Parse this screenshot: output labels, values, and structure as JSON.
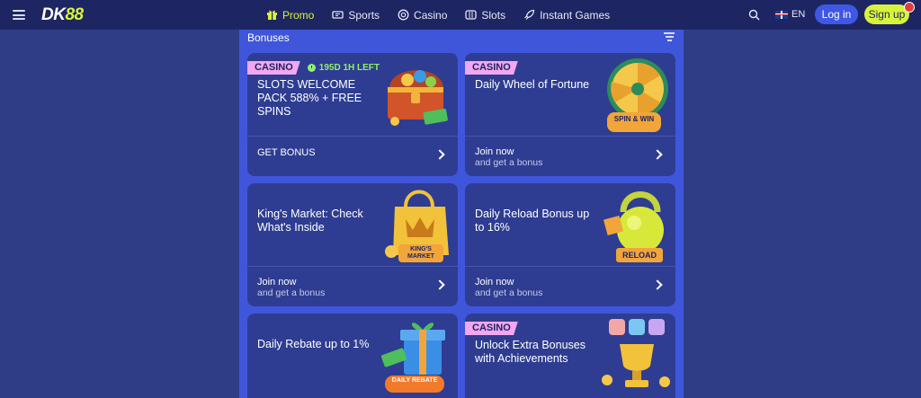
{
  "header": {
    "logo_part1": "DK",
    "logo_part2": "88",
    "nav": [
      {
        "label": "Promo",
        "icon": "gift-icon",
        "active": true
      },
      {
        "label": "Sports",
        "icon": "ticket-icon",
        "active": false
      },
      {
        "label": "Casino",
        "icon": "chip-icon",
        "active": false
      },
      {
        "label": "Slots",
        "icon": "slot-icon",
        "active": false
      },
      {
        "label": "Instant Games",
        "icon": "rocket-icon",
        "active": false
      }
    ],
    "language": "EN",
    "login_label": "Log in",
    "signup_label": "Sign up"
  },
  "panel": {
    "title": "Bonuses"
  },
  "cards": [
    {
      "tag": "CASINO",
      "timer": "195D 1H LEFT",
      "title": "SLOTS WELCOME PACK 588% + FREE SPINS",
      "cta": "GET BONUS",
      "cta_sub": ""
    },
    {
      "tag": "CASINO",
      "timer": "",
      "title": "Daily Wheel of Fortune",
      "cta": "Join now",
      "cta_sub": "and get a bonus",
      "badge": "SPIN & WIN"
    },
    {
      "tag": "",
      "timer": "",
      "title": "King's Market: Check What's Inside",
      "cta": "Join now",
      "cta_sub": "and get a bonus",
      "badge": "KING'S MARKET"
    },
    {
      "tag": "",
      "timer": "",
      "title": "Daily Reload Bonus up to 16%",
      "cta": "Join now",
      "cta_sub": "and get a bonus",
      "badge": "RELOAD"
    },
    {
      "tag": "",
      "timer": "",
      "title": "Daily Rebate up to 1%",
      "cta": "",
      "cta_sub": "",
      "badge": "DAILY REBATE"
    },
    {
      "tag": "CASINO",
      "timer": "",
      "title": "Unlock Extra Bonuses with Achievements",
      "cta": "",
      "cta_sub": "",
      "badge": ""
    }
  ],
  "colors": {
    "background": "#2f3d86",
    "header": "#1d2662",
    "panel": "#3f56db",
    "card": "#2e3d91",
    "accent_lime": "#d8f33c",
    "tag_pink": "#f2a7f0",
    "timer_green": "#8ff06f",
    "login_blue": "#3f57e6"
  }
}
